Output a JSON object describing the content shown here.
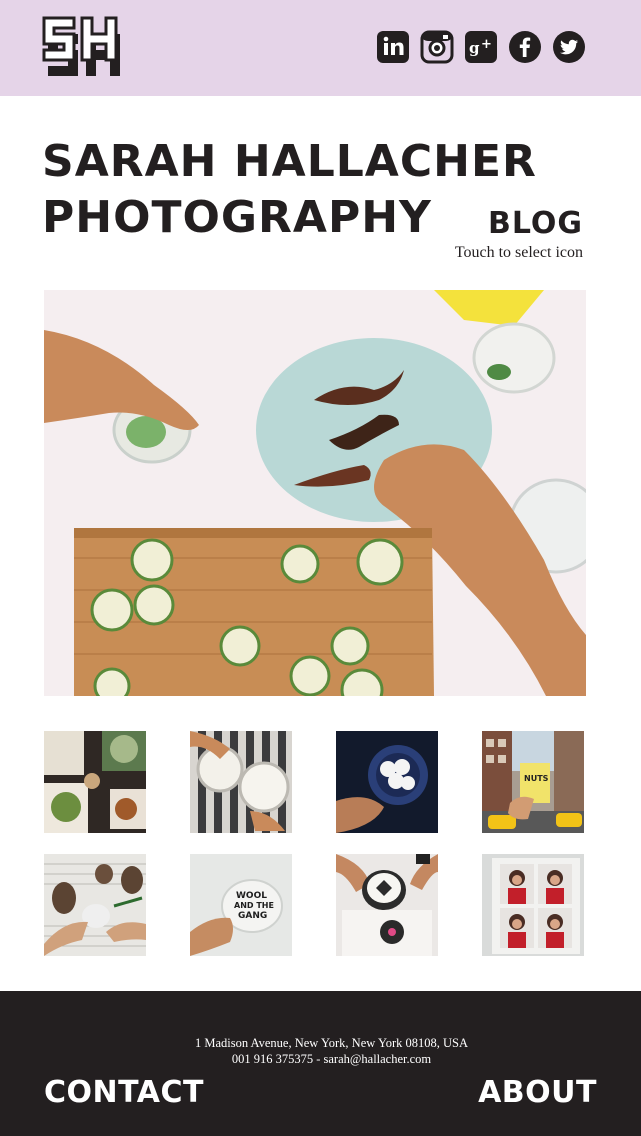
{
  "header": {
    "logo": "SH",
    "social": [
      "linkedin-icon",
      "instagram-icon",
      "google-plus-icon",
      "facebook-icon",
      "twitter-icon"
    ]
  },
  "title": {
    "line1": "SARAH HALLACHER",
    "line2": "PHOTOGRAPHY"
  },
  "section": {
    "label": "BLOG",
    "hint": "Touch to select icon"
  },
  "footer": {
    "address": "1 Madison Avenue, New York, New York 08108, USA",
    "contact_line": "001 916 375375 - sarah@hallacher.com",
    "contact_label": "CONTACT",
    "about_label": "ABOUT"
  },
  "colors": {
    "header_bg": "#e5d4e8",
    "text": "#231f20",
    "footer_bg": "#231f20"
  }
}
